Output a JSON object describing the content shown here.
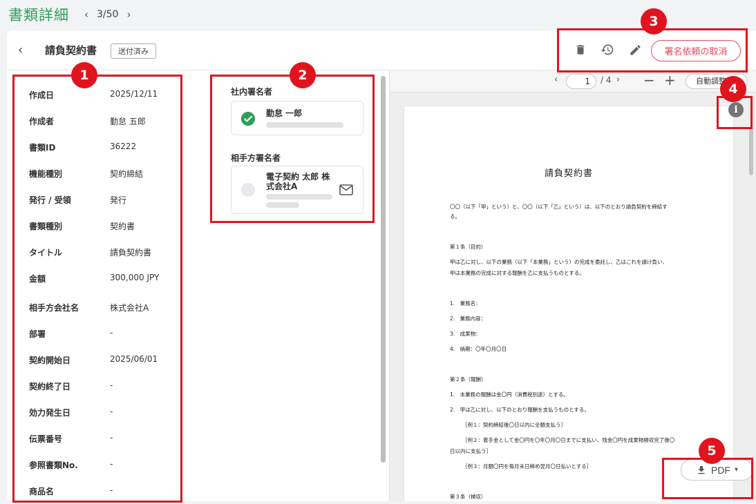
{
  "header": {
    "title": "書類詳細",
    "pager": "3/50"
  },
  "doc": {
    "name": "請負契約書",
    "status": "送付済み",
    "cancel_label": "署名依頼の取消"
  },
  "properties": [
    {
      "label": "作成日",
      "value": "2025/12/11"
    },
    {
      "label": "作成者",
      "value": "勤怠 五郎"
    },
    {
      "label": "書類ID",
      "value": "36222"
    },
    {
      "label": "機能種別",
      "value": "契約締結"
    },
    {
      "label": "発行 / 受領",
      "value": "発行"
    },
    {
      "label": "書類種別",
      "value": "契約書"
    },
    {
      "label": "タイトル",
      "value": "請負契約書"
    },
    {
      "label": "金額",
      "value": "300,000 JPY"
    },
    {
      "label": "相手方会社名",
      "value": "株式会社A"
    },
    {
      "label": "部署",
      "value": "-"
    },
    {
      "label": "契約開始日",
      "value": "2025/06/01"
    },
    {
      "label": "契約終了日",
      "value": "-"
    },
    {
      "label": "効力発生日",
      "value": "-"
    },
    {
      "label": "伝票番号",
      "value": "-"
    },
    {
      "label": "参照書類No.",
      "value": "-"
    },
    {
      "label": "商品名",
      "value": "-"
    }
  ],
  "signers": {
    "internal_label": "社内署名者",
    "internal_name": "勤怠 一郎",
    "counterparty_label": "相手方署名者",
    "counterparty_name_line1": "電子契約 太郎 株",
    "counterparty_name_line2": "式会社A"
  },
  "viewer": {
    "page": "1",
    "total": "/ 4",
    "fit_label": "自動調整"
  },
  "document": {
    "title": "請負契約書",
    "lines": [
      "〇〇（以下「甲」という）と、〇〇（以下「乙」という）は、以下のとおり請負契約を締結す",
      "る。",
      "第１条（目的）",
      "甲は乙に対し、以下の業務（以下「本業務」という）の完成を委託し、乙はこれを請け負い、",
      "甲は本業務の完成に対する報酬を乙に支払うものとする。",
      "1.　業務名：",
      "2.　業務内容：",
      "3.　成果物：",
      "4.　納期：〇年〇月〇日",
      "第２条（報酬）",
      "1.　本業務の報酬は金〇円（消費税別途）とする。",
      "2.　甲は乙に対し、以下のとおり報酬を支払うものとする。",
      "［例１：契約締結後〇日以内に全額支払う］",
      "［例２：着手金として金〇円を〇年〇月〇日までに支払い、残金〇円を成果物検収完了後〇",
      "日以内に支払う］",
      "［例３：月額〇円を毎月末日締め翌月〇日払いとする］",
      "第３条（検収）"
    ]
  },
  "download": {
    "label": "PDF"
  },
  "annotations": [
    "1",
    "2",
    "3",
    "4",
    "5"
  ],
  "colors": {
    "accent": "#2e9e58",
    "danger": "#e34a5b",
    "annotation": "#e0141e"
  }
}
